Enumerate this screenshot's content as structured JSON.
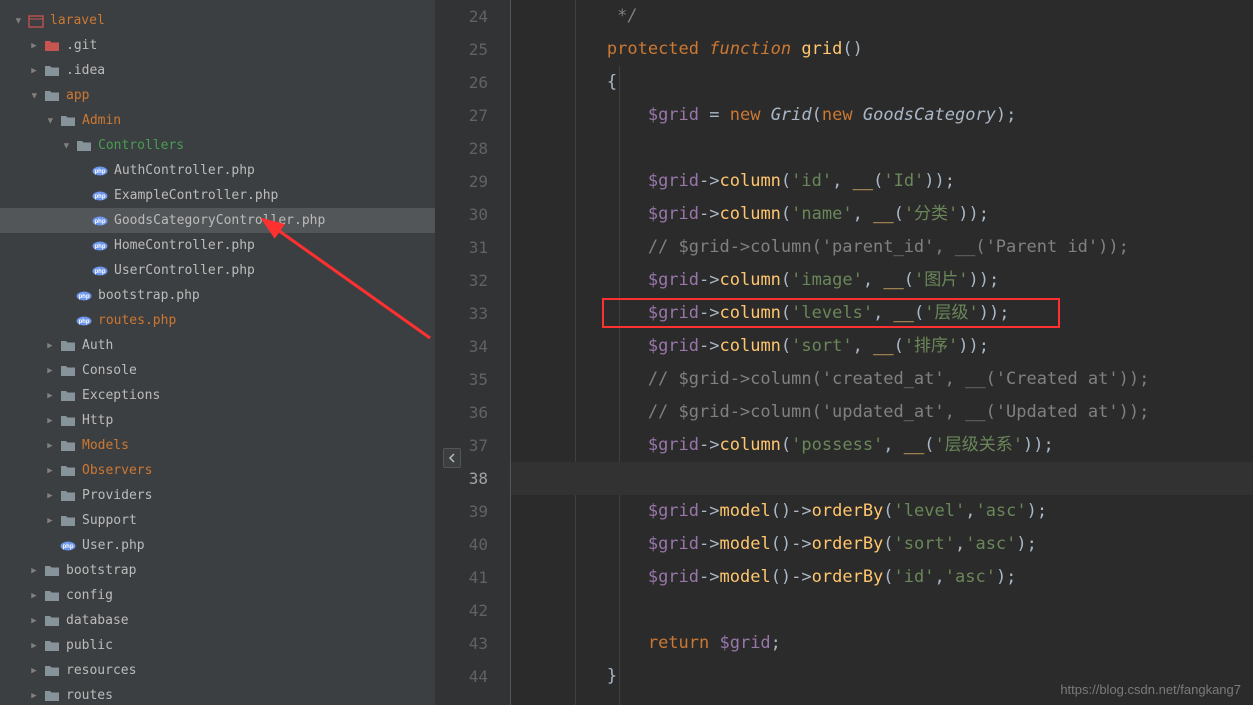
{
  "sidebar": {
    "root": "laravel",
    "items": [
      {
        "label": ".git",
        "indent": 1,
        "type": "folder-red",
        "expanded": false,
        "textClass": ""
      },
      {
        "label": ".idea",
        "indent": 1,
        "type": "folder",
        "expanded": false,
        "textClass": ""
      },
      {
        "label": "app",
        "indent": 1,
        "type": "folder",
        "expanded": true,
        "textClass": "orange"
      },
      {
        "label": "Admin",
        "indent": 2,
        "type": "folder",
        "expanded": true,
        "textClass": "orange"
      },
      {
        "label": "Controllers",
        "indent": 3,
        "type": "folder",
        "expanded": true,
        "textClass": "green"
      },
      {
        "label": "AuthController.php",
        "indent": 4,
        "type": "php",
        "leaf": true,
        "textClass": ""
      },
      {
        "label": "ExampleController.php",
        "indent": 4,
        "type": "php",
        "leaf": true,
        "textClass": ""
      },
      {
        "label": "GoodsCategoryController.php",
        "indent": 4,
        "type": "php",
        "leaf": true,
        "textClass": "",
        "selected": true
      },
      {
        "label": "HomeController.php",
        "indent": 4,
        "type": "php",
        "leaf": true,
        "textClass": ""
      },
      {
        "label": "UserController.php",
        "indent": 4,
        "type": "php",
        "leaf": true,
        "textClass": ""
      },
      {
        "label": "bootstrap.php",
        "indent": 3,
        "type": "php",
        "leaf": true,
        "textClass": ""
      },
      {
        "label": "routes.php",
        "indent": 3,
        "type": "php",
        "leaf": true,
        "textClass": "orange"
      },
      {
        "label": "Auth",
        "indent": 2,
        "type": "folder",
        "expanded": false,
        "textClass": ""
      },
      {
        "label": "Console",
        "indent": 2,
        "type": "folder",
        "expanded": false,
        "textClass": ""
      },
      {
        "label": "Exceptions",
        "indent": 2,
        "type": "folder",
        "expanded": false,
        "textClass": ""
      },
      {
        "label": "Http",
        "indent": 2,
        "type": "folder",
        "expanded": false,
        "textClass": ""
      },
      {
        "label": "Models",
        "indent": 2,
        "type": "folder",
        "expanded": false,
        "textClass": "orange"
      },
      {
        "label": "Observers",
        "indent": 2,
        "type": "folder",
        "expanded": false,
        "textClass": "orange"
      },
      {
        "label": "Providers",
        "indent": 2,
        "type": "folder",
        "expanded": false,
        "textClass": ""
      },
      {
        "label": "Support",
        "indent": 2,
        "type": "folder",
        "expanded": false,
        "textClass": ""
      },
      {
        "label": "User.php",
        "indent": 2,
        "type": "php",
        "leaf": true,
        "textClass": ""
      },
      {
        "label": "bootstrap",
        "indent": 1,
        "type": "folder",
        "expanded": false,
        "textClass": ""
      },
      {
        "label": "config",
        "indent": 1,
        "type": "folder",
        "expanded": false,
        "textClass": ""
      },
      {
        "label": "database",
        "indent": 1,
        "type": "folder",
        "expanded": false,
        "textClass": ""
      },
      {
        "label": "public",
        "indent": 1,
        "type": "folder",
        "expanded": false,
        "textClass": ""
      },
      {
        "label": "resources",
        "indent": 1,
        "type": "folder",
        "expanded": false,
        "textClass": ""
      },
      {
        "label": "routes",
        "indent": 1,
        "type": "folder",
        "expanded": false,
        "textClass": ""
      }
    ]
  },
  "gutter": {
    "start": 24,
    "end": 44,
    "current": 38
  },
  "code": {
    "lines": [
      {
        "n": 24,
        "tokens": [
          {
            "t": "         */",
            "c": "cmtdoc"
          }
        ]
      },
      {
        "n": 25,
        "tokens": [
          {
            "t": "        ",
            "c": ""
          },
          {
            "t": "protected ",
            "c": "k"
          },
          {
            "t": "function ",
            "c": "kf"
          },
          {
            "t": "grid",
            "c": "fn"
          },
          {
            "t": "()",
            "c": "paren"
          }
        ]
      },
      {
        "n": 26,
        "tokens": [
          {
            "t": "        {",
            "c": "brace"
          }
        ]
      },
      {
        "n": 27,
        "tokens": [
          {
            "t": "            ",
            "c": ""
          },
          {
            "t": "$grid",
            "c": "var"
          },
          {
            "t": " = ",
            "c": "op"
          },
          {
            "t": "new ",
            "c": "k"
          },
          {
            "t": "Grid",
            "c": "cls"
          },
          {
            "t": "(",
            "c": "paren"
          },
          {
            "t": "new ",
            "c": "k"
          },
          {
            "t": "GoodsCategory",
            "c": "cls"
          },
          {
            "t": ");",
            "c": "paren"
          }
        ]
      },
      {
        "n": 28,
        "tokens": [
          {
            "t": "",
            "c": ""
          }
        ]
      },
      {
        "n": 29,
        "tokens": [
          {
            "t": "            ",
            "c": ""
          },
          {
            "t": "$grid",
            "c": "var"
          },
          {
            "t": "->",
            "c": "arrow-op"
          },
          {
            "t": "column",
            "c": "method"
          },
          {
            "t": "(",
            "c": "paren"
          },
          {
            "t": "'id'",
            "c": "str"
          },
          {
            "t": ", ",
            "c": "op"
          },
          {
            "t": "__",
            "c": "fn"
          },
          {
            "t": "(",
            "c": "paren"
          },
          {
            "t": "'Id'",
            "c": "str"
          },
          {
            "t": "));",
            "c": "paren"
          }
        ]
      },
      {
        "n": 30,
        "tokens": [
          {
            "t": "            ",
            "c": ""
          },
          {
            "t": "$grid",
            "c": "var"
          },
          {
            "t": "->",
            "c": "arrow-op"
          },
          {
            "t": "column",
            "c": "method"
          },
          {
            "t": "(",
            "c": "paren"
          },
          {
            "t": "'name'",
            "c": "str"
          },
          {
            "t": ", ",
            "c": "op"
          },
          {
            "t": "__",
            "c": "fn"
          },
          {
            "t": "(",
            "c": "paren"
          },
          {
            "t": "'分类'",
            "c": "str"
          },
          {
            "t": "));",
            "c": "paren"
          }
        ]
      },
      {
        "n": 31,
        "tokens": [
          {
            "t": "            // $grid->column('parent_id', __('Parent id'));",
            "c": "cmt"
          }
        ]
      },
      {
        "n": 32,
        "tokens": [
          {
            "t": "            ",
            "c": ""
          },
          {
            "t": "$grid",
            "c": "var"
          },
          {
            "t": "->",
            "c": "arrow-op"
          },
          {
            "t": "column",
            "c": "method"
          },
          {
            "t": "(",
            "c": "paren"
          },
          {
            "t": "'image'",
            "c": "str"
          },
          {
            "t": ", ",
            "c": "op"
          },
          {
            "t": "__",
            "c": "fn"
          },
          {
            "t": "(",
            "c": "paren"
          },
          {
            "t": "'图片'",
            "c": "str"
          },
          {
            "t": "));",
            "c": "paren"
          }
        ]
      },
      {
        "n": 33,
        "tokens": [
          {
            "t": "            ",
            "c": ""
          },
          {
            "t": "$grid",
            "c": "var"
          },
          {
            "t": "->",
            "c": "arrow-op"
          },
          {
            "t": "column",
            "c": "method"
          },
          {
            "t": "(",
            "c": "paren"
          },
          {
            "t": "'levels'",
            "c": "str"
          },
          {
            "t": ", ",
            "c": "op"
          },
          {
            "t": "__",
            "c": "fn"
          },
          {
            "t": "(",
            "c": "paren"
          },
          {
            "t": "'层级'",
            "c": "str"
          },
          {
            "t": "));",
            "c": "paren"
          }
        ]
      },
      {
        "n": 34,
        "tokens": [
          {
            "t": "            ",
            "c": ""
          },
          {
            "t": "$grid",
            "c": "var"
          },
          {
            "t": "->",
            "c": "arrow-op"
          },
          {
            "t": "column",
            "c": "method"
          },
          {
            "t": "(",
            "c": "paren"
          },
          {
            "t": "'sort'",
            "c": "str"
          },
          {
            "t": ", ",
            "c": "op"
          },
          {
            "t": "__",
            "c": "fn"
          },
          {
            "t": "(",
            "c": "paren"
          },
          {
            "t": "'排序'",
            "c": "str"
          },
          {
            "t": "));",
            "c": "paren"
          }
        ]
      },
      {
        "n": 35,
        "tokens": [
          {
            "t": "            // $grid->column('created_at', __('Created at'));",
            "c": "cmt"
          }
        ]
      },
      {
        "n": 36,
        "tokens": [
          {
            "t": "            // $grid->column('updated_at', __('Updated at'));",
            "c": "cmt"
          }
        ]
      },
      {
        "n": 37,
        "tokens": [
          {
            "t": "            ",
            "c": ""
          },
          {
            "t": "$grid",
            "c": "var"
          },
          {
            "t": "->",
            "c": "arrow-op"
          },
          {
            "t": "column",
            "c": "method"
          },
          {
            "t": "(",
            "c": "paren"
          },
          {
            "t": "'possess'",
            "c": "str"
          },
          {
            "t": ", ",
            "c": "op"
          },
          {
            "t": "__",
            "c": "fn"
          },
          {
            "t": "(",
            "c": "paren"
          },
          {
            "t": "'层级关系'",
            "c": "str"
          },
          {
            "t": "));",
            "c": "paren"
          }
        ]
      },
      {
        "n": 38,
        "tokens": [
          {
            "t": "",
            "c": ""
          }
        ],
        "current": true
      },
      {
        "n": 39,
        "tokens": [
          {
            "t": "            ",
            "c": ""
          },
          {
            "t": "$grid",
            "c": "var"
          },
          {
            "t": "->",
            "c": "arrow-op"
          },
          {
            "t": "model",
            "c": "method"
          },
          {
            "t": "()->",
            "c": "arrow-op"
          },
          {
            "t": "orderBy",
            "c": "method"
          },
          {
            "t": "(",
            "c": "paren"
          },
          {
            "t": "'level'",
            "c": "str"
          },
          {
            "t": ",",
            "c": "op"
          },
          {
            "t": "'asc'",
            "c": "str"
          },
          {
            "t": ");",
            "c": "paren"
          }
        ]
      },
      {
        "n": 40,
        "tokens": [
          {
            "t": "            ",
            "c": ""
          },
          {
            "t": "$grid",
            "c": "var"
          },
          {
            "t": "->",
            "c": "arrow-op"
          },
          {
            "t": "model",
            "c": "method"
          },
          {
            "t": "()->",
            "c": "arrow-op"
          },
          {
            "t": "orderBy",
            "c": "method"
          },
          {
            "t": "(",
            "c": "paren"
          },
          {
            "t": "'sort'",
            "c": "str"
          },
          {
            "t": ",",
            "c": "op"
          },
          {
            "t": "'asc'",
            "c": "str"
          },
          {
            "t": ");",
            "c": "paren"
          }
        ]
      },
      {
        "n": 41,
        "tokens": [
          {
            "t": "            ",
            "c": ""
          },
          {
            "t": "$grid",
            "c": "var"
          },
          {
            "t": "->",
            "c": "arrow-op"
          },
          {
            "t": "model",
            "c": "method"
          },
          {
            "t": "()->",
            "c": "arrow-op"
          },
          {
            "t": "orderBy",
            "c": "method"
          },
          {
            "t": "(",
            "c": "paren"
          },
          {
            "t": "'id'",
            "c": "str"
          },
          {
            "t": ",",
            "c": "op"
          },
          {
            "t": "'asc'",
            "c": "str"
          },
          {
            "t": ");",
            "c": "paren"
          }
        ]
      },
      {
        "n": 42,
        "tokens": [
          {
            "t": "",
            "c": ""
          }
        ]
      },
      {
        "n": 43,
        "tokens": [
          {
            "t": "            ",
            "c": ""
          },
          {
            "t": "return ",
            "c": "k"
          },
          {
            "t": "$grid",
            "c": "var"
          },
          {
            "t": ";",
            "c": "op"
          }
        ]
      },
      {
        "n": 44,
        "tokens": [
          {
            "t": "        }",
            "c": "brace"
          }
        ]
      }
    ]
  },
  "watermark": "https://blog.csdn.net/fangkang7"
}
